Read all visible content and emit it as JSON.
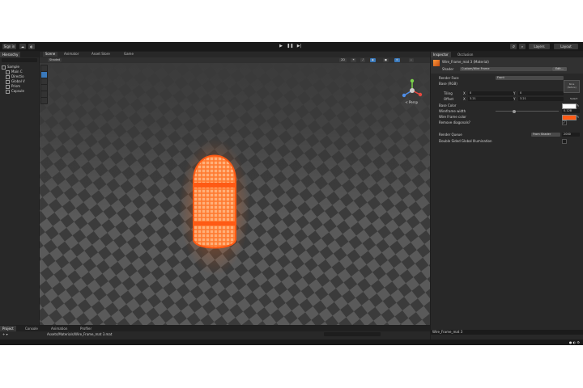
{
  "toolbar": {
    "account": "Sign in",
    "layers": "Layers",
    "layout": "Layout"
  },
  "hierarchy": {
    "tab": "Hierarchy",
    "root": "Sample",
    "items": [
      "Main C",
      "Directio",
      "Global V",
      "Prism",
      "Capsule"
    ]
  },
  "scene_tabs": [
    "Scene",
    "Animator",
    "Asset Store",
    "Game"
  ],
  "scene": {
    "shading": "Shaded",
    "mode": "2D",
    "gizmo_label": "< Persp"
  },
  "inspector": {
    "tabs": [
      "Inspector",
      "Occlusion"
    ],
    "material_name": "Wire_Frame_mat 3 (Material)",
    "shader_label": "Shader",
    "shader_value": "Custom/Wire Frame",
    "edit_button": "Edit...",
    "render_face_label": "Render Face",
    "render_face_value": "Front",
    "base_label": "Base (RGB)",
    "none_label": "None (Texture)",
    "tiling_label": "Tiling",
    "offset_label": "Offset",
    "tiling": {
      "x": "0",
      "y": "0"
    },
    "offset": {
      "x": "3.21",
      "y": "3.21"
    },
    "select_button": "Select",
    "base_color_label": "Base Color",
    "wire_width_label": "Wireframe width",
    "wire_width_value": "0.128",
    "wire_color_label": "Wire Frame color",
    "remove_diag_label": "Remove diagonals?",
    "render_queue_label": "Render Queue",
    "render_queue_mode": "From Shader",
    "render_queue_value": "2000",
    "double_sided_label": "Double Sided Global Illumination",
    "wire_color_hex": "#ff5a14"
  },
  "bottom": {
    "tabs": [
      "Project",
      "Console",
      "Animation",
      "Profiler"
    ],
    "path": "Assets/Materials/Wire_Frame_mat 3.mat",
    "asset_label": "Wire_Frame_mat 3"
  }
}
